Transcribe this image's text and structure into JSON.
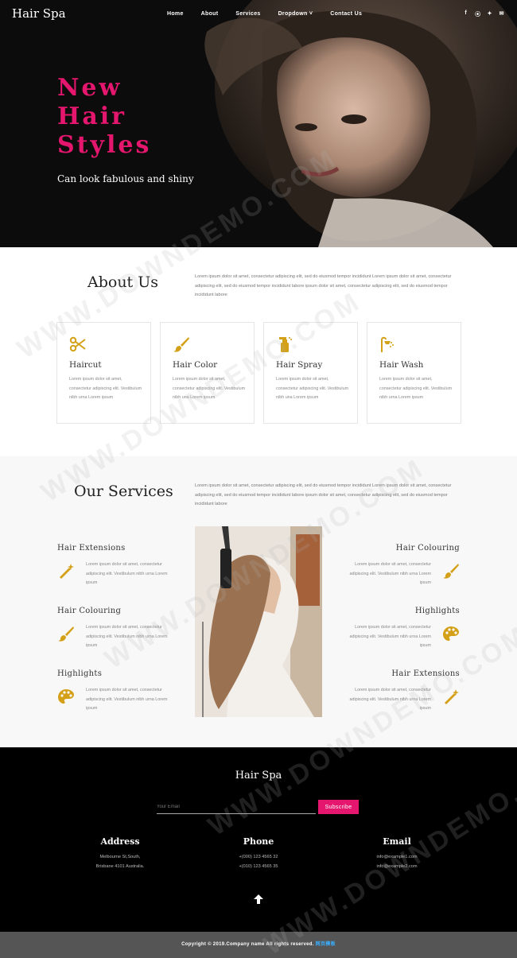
{
  "header": {
    "brand": "Hair Spa",
    "nav": [
      "Home",
      "About",
      "Services",
      "Dropdown ˅",
      "Contact Us"
    ],
    "social": [
      {
        "icon": "facebook-icon",
        "glyph": "f"
      },
      {
        "icon": "rss-icon",
        "glyph": "⦿"
      },
      {
        "icon": "twitter-icon",
        "glyph": "✦"
      },
      {
        "icon": "mail-icon",
        "glyph": "✉"
      }
    ]
  },
  "hero": {
    "title_lines": [
      "New",
      "Hair",
      "Styles"
    ],
    "subtitle": "Can look fabulous and shiny",
    "accent_color": "#e4166d"
  },
  "about": {
    "title": "About Us",
    "text": "Lorem ipsum dolor sit amet, consectetur adipiscing elit, sed do eiusmod tempor incididunt Lorem ipsum dolor sit amet, consectetur adipiscing elit, sed do eiusmod tempor incididunt labore ipsum dolor sit amet, consectetur adipiscing elit, sed do eiusmod tempor incididunt labore",
    "cards": [
      {
        "title": "Haircut",
        "icon": "scissors-icon",
        "text": "Lorem ipsum dolor sit amet, consectetur adipiscing elit. Vestibulum nibh urna Lorem ipsum"
      },
      {
        "title": "Hair Color",
        "icon": "brush-icon",
        "text": "Lorem ipsum dolor sit amet, consectetur adipiscing elit. Vestibulum nibh una Lorem ipsum"
      },
      {
        "title": "Hair Spray",
        "icon": "spray-icon",
        "text": "Lorem ipsum dolor sit amet, consectetur adipiscing elit. Vestibulum nibh una Lorem ipsum"
      },
      {
        "title": "Hair Wash",
        "icon": "shower-icon",
        "text": "Lorem ipsum dolor sit amet, consectetur adipiscing elit. Vestibulum nibh urna Lorem ipsum"
      }
    ]
  },
  "services": {
    "title": "Our Services",
    "text": "Lorem ipsum dolor sit amet, consectetur adipiscing elit, sed do eiusmod tempor incididunt Lorem ipsum dolor sit amet, consectetur adipiscing elit, sed do eiusmod tempor incididunt labore ipsum dolor sit amet, consectetur adipiscing elit, sed do eiusmod tempor incididunt labore",
    "left": [
      {
        "title": "Hair Extensions",
        "icon": "wand-icon",
        "text": "Lorem ipsum dolor sit amet, consectetur adipiscing elit. Vestibulum nibh urna Lorem ipsum"
      },
      {
        "title": "Hair Colouring",
        "icon": "brush-icon",
        "text": "Lorem ipsum dolor sit amet, consectetur adipiscing elit. Vestibulum nibh urna Lorem ipsum"
      },
      {
        "title": "Highlights",
        "icon": "palette-icon",
        "text": "Lorem ipsum dolor sit amet, consectetur adipiscing elit. Vestibulum nibh urna Lorem ipsum"
      }
    ],
    "right": [
      {
        "title": "Hair Colouring",
        "icon": "brush-icon",
        "text": "Lorem ipsum dolor sit amet, consectetur adipiscing elit. Vestibulum nibh urna Lorem ipsum"
      },
      {
        "title": "Highlights",
        "icon": "palette-icon",
        "text": "Lorem ipsum dolor sit amet, consectetur adipiscing elit. Vestibulum nibh urna Lorem ipsum"
      },
      {
        "title": "Hair Extensions",
        "icon": "wand-icon",
        "text": "Lorem ipsum dolor sit amet, consectetur adipiscing elit. Vestibulum nibh urna Lorem ipsum"
      }
    ]
  },
  "footer": {
    "title": "Hair Spa",
    "email_placeholder": "Your Email",
    "subscribe_label": "Subscribe",
    "columns": [
      {
        "title": "Address",
        "lines": [
          "Melbourne St,South,",
          "Brisbane 4101 Australia."
        ]
      },
      {
        "title": "Phone",
        "lines": [
          "+(000) 123 4565 32",
          "+(010) 123 4565 35"
        ]
      },
      {
        "title": "Email",
        "lines": [
          "info@example1.com",
          "info@example2.com"
        ]
      }
    ],
    "copyright": "Copyright © 2019.Company name All rights reserved.",
    "copyright_link": "网页模板"
  },
  "watermark": "WWW.DOWNDEMO.COM",
  "icon_color": "#d4a017"
}
